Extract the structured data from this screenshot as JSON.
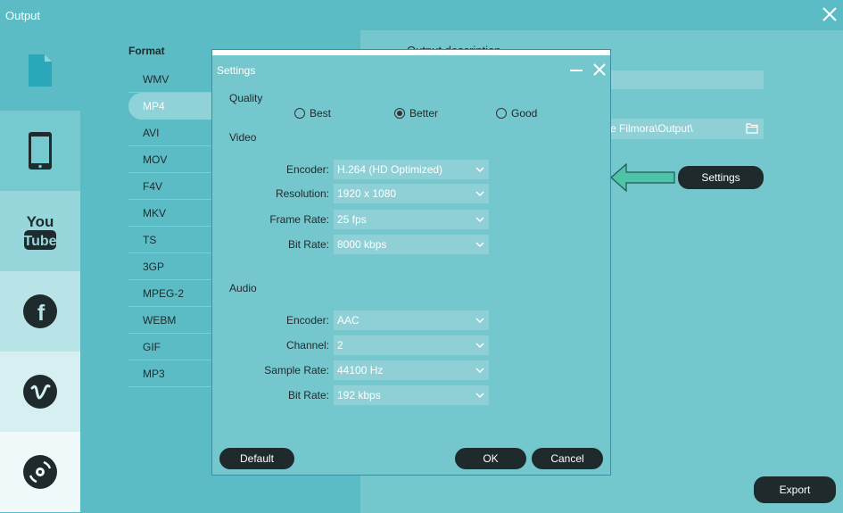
{
  "window": {
    "title": "Output"
  },
  "sidebar": {
    "items": [
      {
        "icon": "file-icon",
        "label": "Format"
      },
      {
        "icon": "phone-icon",
        "label": "Device"
      },
      {
        "icon": "youtube-icon",
        "label": "YouTube"
      },
      {
        "icon": "facebook-icon",
        "label": "Facebook"
      },
      {
        "icon": "vimeo-icon",
        "label": "Vimeo"
      },
      {
        "icon": "disc-icon",
        "label": "DVD"
      }
    ]
  },
  "formats": {
    "label": "Format",
    "items": [
      "WMV",
      "MP4",
      "AVI",
      "MOV",
      "F4V",
      "MKV",
      "TS",
      "3GP",
      "MPEG-2",
      "WEBM",
      "GIF",
      "MP3"
    ],
    "selected": "MP4"
  },
  "output": {
    "description_title": "Output description",
    "path": "re Filmora\\Output\\",
    "settings_label": "Settings",
    "export_label": "Export"
  },
  "dialog": {
    "title": "Settings",
    "quality_label": "Quality",
    "quality": {
      "best": "Best",
      "better": "Better",
      "good": "Good",
      "selected": "Better"
    },
    "video_label": "Video",
    "video": {
      "encoder_label": "Encoder:",
      "encoder": "H.264 (HD Optimized)",
      "resolution_label": "Resolution:",
      "resolution": "1920 x 1080",
      "framerate_label": "Frame Rate:",
      "framerate": "25 fps",
      "bitrate_label": "Bit Rate:",
      "bitrate": "8000 kbps"
    },
    "audio_label": "Audio",
    "audio": {
      "encoder_label": "Encoder:",
      "encoder": "AAC",
      "channel_label": "Channel:",
      "channel": "2",
      "samplerate_label": "Sample Rate:",
      "samplerate": "44100 Hz",
      "bitrate_label": "Bit Rate:",
      "bitrate": "192 kbps"
    },
    "default_label": "Default",
    "ok_label": "OK",
    "cancel_label": "Cancel"
  },
  "colors": {
    "accent": "#5bbcc5",
    "dark_button": "#1e2a2c",
    "arrow": "#4fc3a8"
  }
}
